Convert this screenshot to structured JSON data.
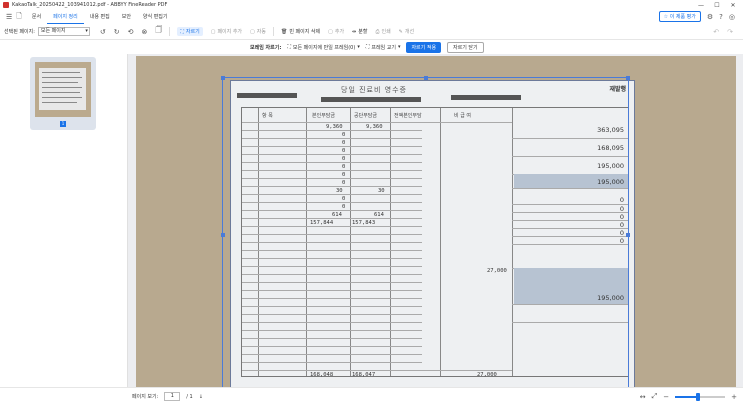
{
  "window": {
    "title": "KakaoTalk_20250422_103941012.pdf - ABBYY FineReader PDF",
    "minimize": "—",
    "maximize": "☐",
    "close": "✕"
  },
  "menu": {
    "items": [
      "문서",
      "페이지 정리",
      "내용 편집",
      "보안",
      "양식 편집기"
    ],
    "active_index": 1,
    "upgrade_label": "이 제품 평가"
  },
  "toolbar": {
    "select_label": "선택된 페이지:",
    "select_value": "모든 페이지",
    "crop_label": "자르기",
    "page_crop_label": "페이지 추가",
    "delete_label": "자동",
    "blank_page_label": "빈 페이지 삭제",
    "insert_label": "추가",
    "split_label": "분할",
    "print_label": "인쇄",
    "correct_label": "개선"
  },
  "cropbar": {
    "label": "모레임 자르기:",
    "option1": "모든 페이지에 만일 프레임(0)",
    "option2": "프레임 교기",
    "apply": "자르기 적용",
    "close": "자르기 닫기"
  },
  "thumbnail": {
    "page_number": "1"
  },
  "document": {
    "title": "당일 진료비 영수증",
    "top_right": "재발행",
    "headers": {
      "category": "항 목",
      "insured_self": "본인부담금",
      "insured_fund": "공단부담금",
      "full_self": "전액본인부담",
      "noncovered": "비 급 여"
    },
    "left_values": [
      "9,360",
      "9,360",
      "0",
      "0",
      "0",
      "0",
      "0",
      "0",
      "0",
      "30",
      "30",
      "0",
      "0",
      "614",
      "614",
      "157,844",
      "157,843"
    ],
    "noncovered_value": "27,000",
    "totals": {
      "self": "168,048",
      "fund": "168,047",
      "noncovered": "27,000"
    },
    "right_values": [
      "363,095",
      "168,095",
      "195,000",
      "195,000",
      "0",
      "0",
      "0",
      "0",
      "0",
      "0",
      "195,000"
    ]
  },
  "status": {
    "page_label": "페이지 보기:",
    "page_value": "1",
    "of_label": "/ 1"
  },
  "zoom": {
    "level_fraction": 0.45
  }
}
